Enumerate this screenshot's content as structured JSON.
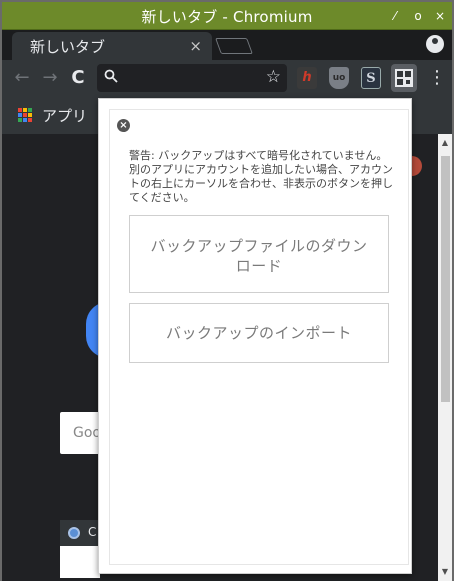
{
  "window": {
    "title": "新しいタブ - Chromium",
    "controls": {
      "minimize": "⁄",
      "maximize": "o",
      "close": "×"
    }
  },
  "tab": {
    "label": "新しいタブ",
    "close": "×"
  },
  "toolbar": {
    "back": "←",
    "forward": "→",
    "reload": "C",
    "omnibox_value": "",
    "star": "☆",
    "menu": "⋮",
    "extensions": [
      {
        "name": "h-extension",
        "glyph": "h"
      },
      {
        "name": "ublock-extension",
        "glyph": "uo"
      },
      {
        "name": "s-extension",
        "glyph": "S"
      },
      {
        "name": "qr-extension",
        "glyph": ""
      }
    ]
  },
  "bookmarks": {
    "apps_label": "アプリ",
    "apps_colors": [
      "#ea4335",
      "#fbbc05",
      "#34a853",
      "#4285f4",
      "#ea4335",
      "#fbbc05",
      "#34a853",
      "#4285f4",
      "#ea4335"
    ]
  },
  "page": {
    "search_placeholder": "Goo",
    "tile_label": "C"
  },
  "popup": {
    "close": "×",
    "warning": "警告: バックアップはすべて暗号化されていません。別のアプリにアカウントを追加したい場合、アカウントの右上にカーソルを合わせ、非表示のボタンを押してください。",
    "download_button": "バックアップファイルのダウンロード",
    "import_button": "バックアップのインポート"
  },
  "colors": {
    "titlebar": "#6d8a2a",
    "toolbar": "#323639",
    "page_bg": "#202124"
  }
}
